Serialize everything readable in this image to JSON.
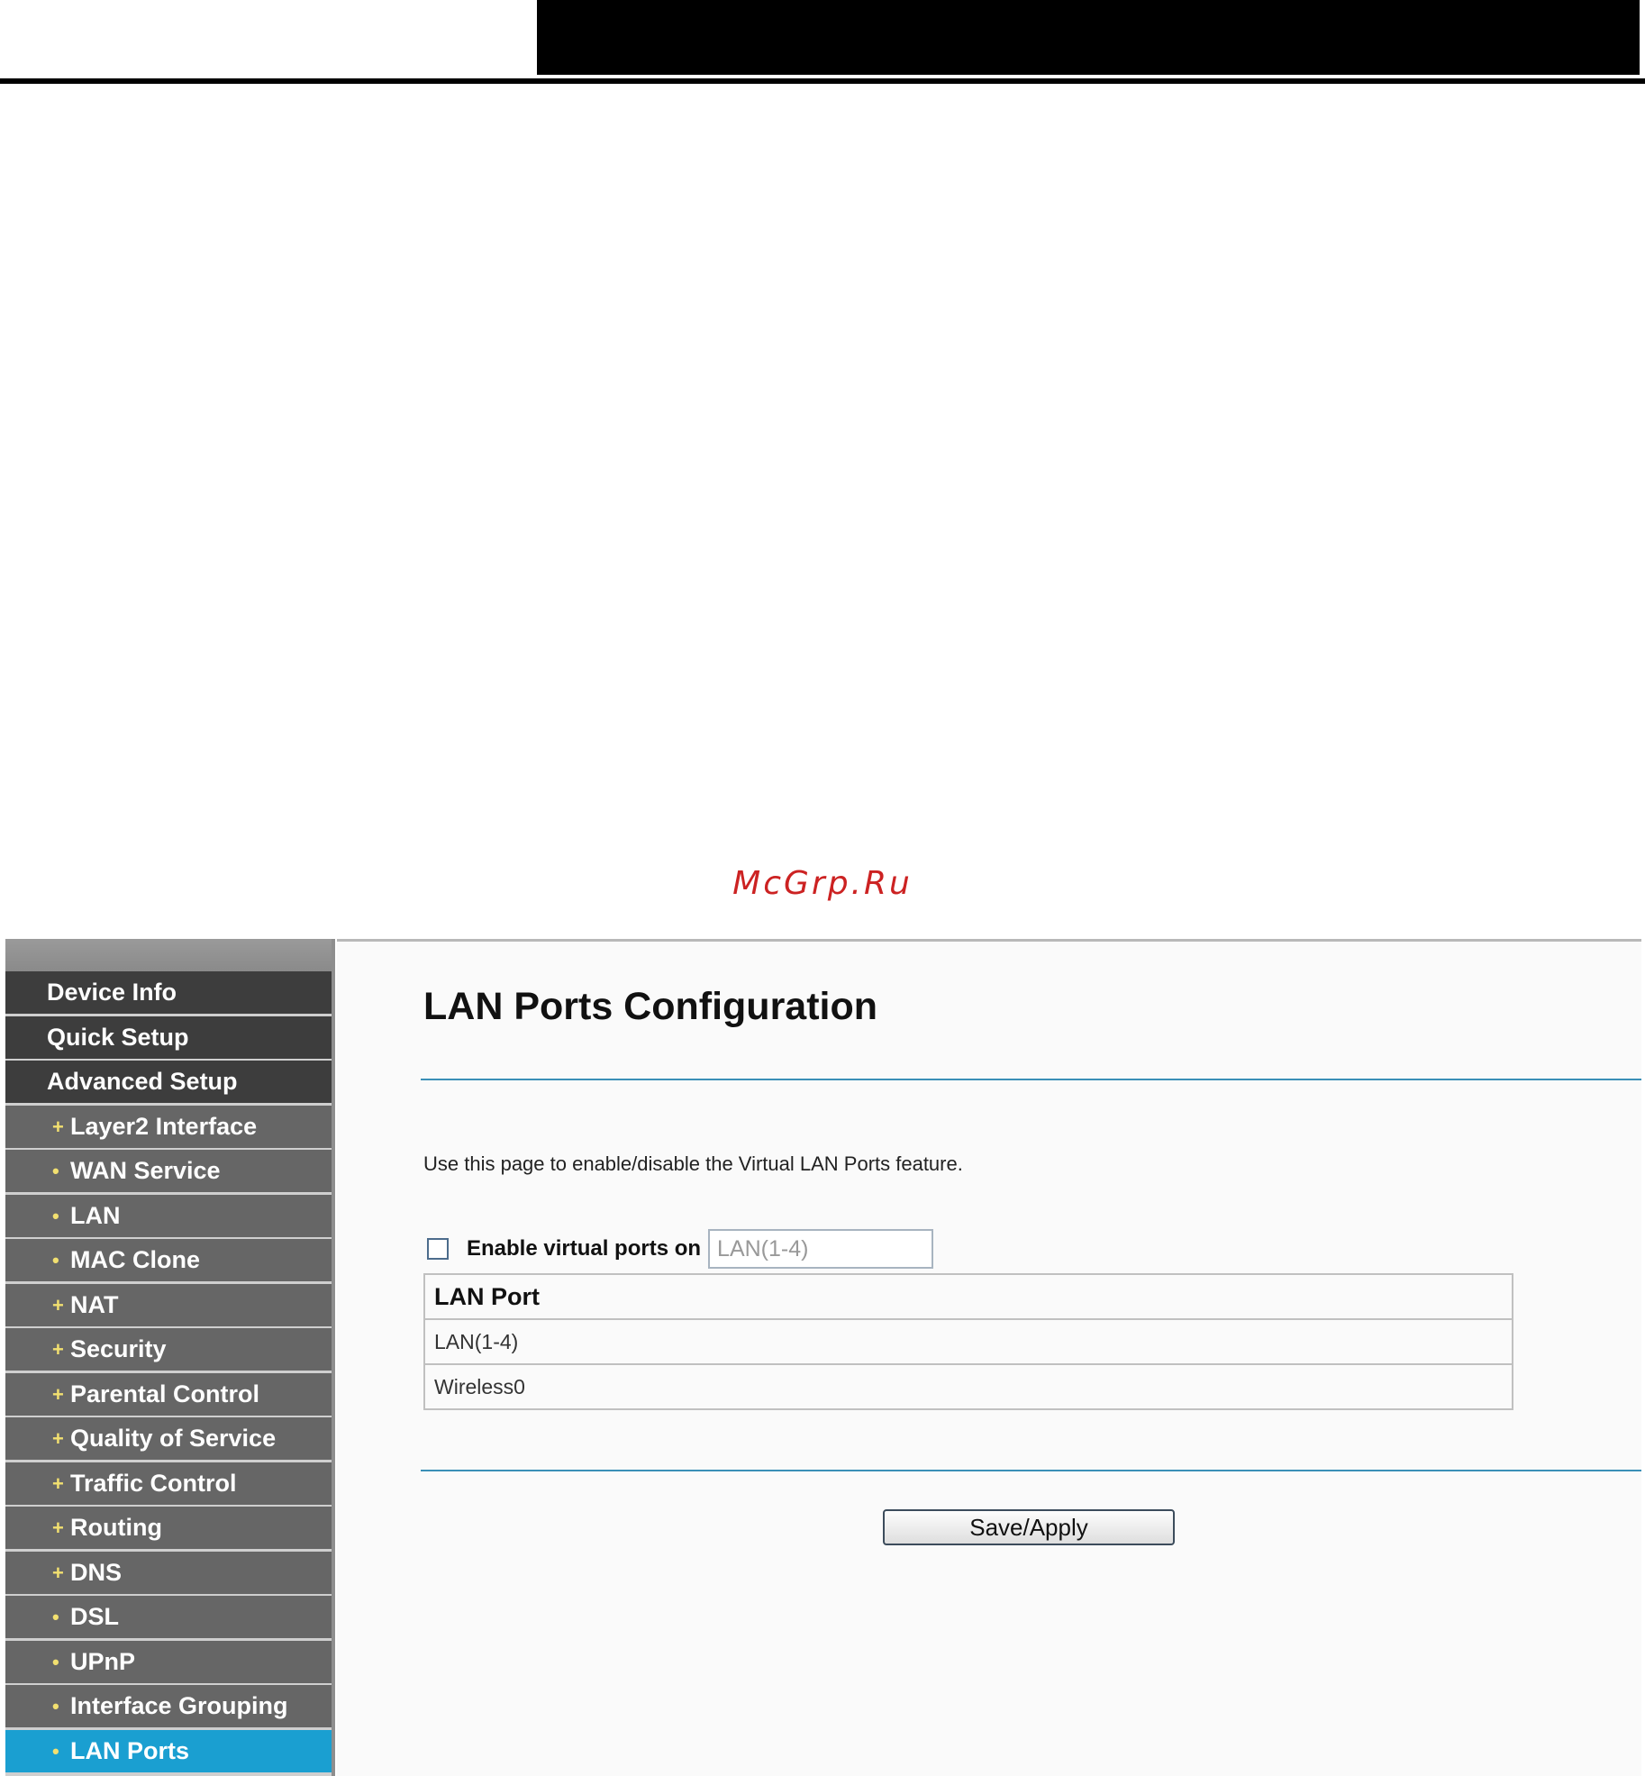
{
  "watermark": "McGrp.Ru",
  "sidebar": {
    "items": [
      {
        "label": "Device Info",
        "level": "top"
      },
      {
        "label": "Quick Setup",
        "level": "top"
      },
      {
        "label": "Advanced Setup",
        "level": "top"
      },
      {
        "label": "Layer2 Interface",
        "level": "sub",
        "bullet": "+"
      },
      {
        "label": "WAN Service",
        "level": "sub",
        "bullet": "•"
      },
      {
        "label": "LAN",
        "level": "sub",
        "bullet": "•"
      },
      {
        "label": "MAC Clone",
        "level": "sub",
        "bullet": "•"
      },
      {
        "label": "NAT",
        "level": "sub",
        "bullet": "+"
      },
      {
        "label": "Security",
        "level": "sub",
        "bullet": "+"
      },
      {
        "label": "Parental Control",
        "level": "sub",
        "bullet": "+"
      },
      {
        "label": "Quality of Service",
        "level": "sub",
        "bullet": "+"
      },
      {
        "label": "Traffic Control",
        "level": "sub",
        "bullet": "+"
      },
      {
        "label": "Routing",
        "level": "sub",
        "bullet": "+"
      },
      {
        "label": "DNS",
        "level": "sub",
        "bullet": "+"
      },
      {
        "label": "DSL",
        "level": "sub",
        "bullet": "•"
      },
      {
        "label": "UPnP",
        "level": "sub",
        "bullet": "•"
      },
      {
        "label": "Interface Grouping",
        "level": "sub",
        "bullet": "•"
      },
      {
        "label": "LAN Ports",
        "level": "sub",
        "bullet": "•",
        "active": true
      }
    ]
  },
  "main": {
    "title": "LAN Ports Configuration",
    "description": "Use this page to enable/disable the Virtual LAN Ports feature.",
    "enable_label": "Enable virtual ports on",
    "enable_checked": false,
    "port_select_value": "LAN(1-4)",
    "table": {
      "header": "LAN Port",
      "rows": [
        "LAN(1-4)",
        "Wireless0"
      ]
    },
    "save_label": "Save/Apply"
  },
  "colors": {
    "active_nav": "#1a9fd1",
    "top_nav": "#3d3d3d",
    "sub_nav": "#666666",
    "rule": "#3a8fb7",
    "watermark": "#cc2222"
  }
}
